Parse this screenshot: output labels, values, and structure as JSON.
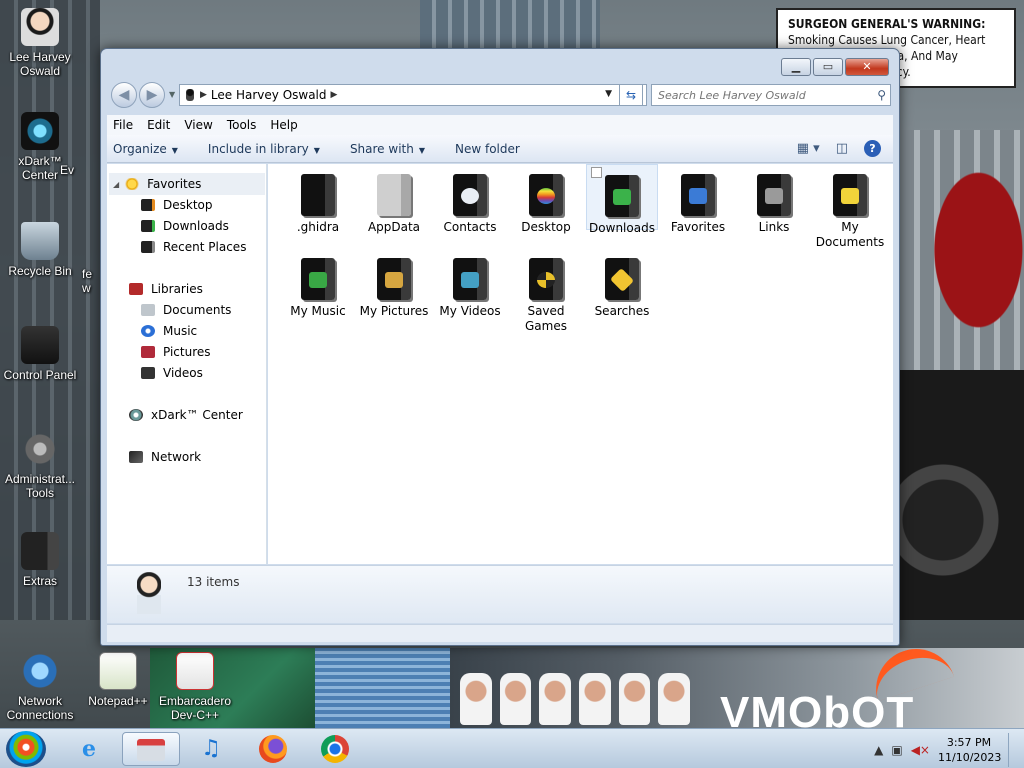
{
  "desktop": {
    "warning": {
      "title": "SURGEON GENERAL'S WARNING:",
      "body": "Smoking Causes Lung Cancer, Heart Disease, Emphysema, And May Complicate Pregnancy."
    },
    "icons": [
      {
        "label": "Lee Harvey Oswald"
      },
      {
        "label": "xDark™ Center"
      },
      {
        "label": "Recycle Bin"
      },
      {
        "label": "Control Panel"
      },
      {
        "label": "Administrat... Tools"
      },
      {
        "label": "Extras"
      },
      {
        "label": "Network Connections"
      },
      {
        "label": "Notepad++"
      },
      {
        "label": "Embarcadero Dev-C++"
      }
    ],
    "partial_labels": {
      "ev": "Ev",
      "fe": "fe",
      "w": "w"
    },
    "brand_text": "VMObOT"
  },
  "window": {
    "address": {
      "crumb": "Lee Harvey Oswald"
    },
    "search": {
      "placeholder": "Search Lee Harvey Oswald"
    },
    "menu": [
      "File",
      "Edit",
      "View",
      "Tools",
      "Help"
    ],
    "toolbar": {
      "organize": "Organize",
      "include": "Include in library",
      "share": "Share with",
      "new_folder": "New folder"
    },
    "nav": {
      "favorites": "Favorites",
      "fav_items": [
        "Desktop",
        "Downloads",
        "Recent Places"
      ],
      "libraries": "Libraries",
      "lib_items": [
        "Documents",
        "Music",
        "Pictures",
        "Videos"
      ],
      "xdark": "xDark™ Center",
      "network": "Network"
    },
    "items": [
      {
        "name": ".ghidra",
        "badge": "none"
      },
      {
        "name": "AppData",
        "badge": "gray"
      },
      {
        "name": "Contacts",
        "badge": "#e9eef5"
      },
      {
        "name": "Desktop",
        "badge": "#f29a1f"
      },
      {
        "name": "Downloads",
        "badge": "#3bb24a"
      },
      {
        "name": "Favorites",
        "badge": "#3b7bd6"
      },
      {
        "name": "Links",
        "badge": "#9a9a9a"
      },
      {
        "name": "My Documents",
        "badge": "#f1d43a"
      },
      {
        "name": "My Music",
        "badge": "#39a845"
      },
      {
        "name": "My Pictures",
        "badge": "#d6a640"
      },
      {
        "name": "My Videos",
        "badge": "#44a0c4"
      },
      {
        "name": "Saved Games",
        "badge": "#e8c02a"
      },
      {
        "name": "Searches",
        "badge": "#f2c531"
      }
    ],
    "selected_item": "Downloads",
    "status": {
      "count": "13 items"
    }
  },
  "taskbar": {
    "clock_time": "3:57 PM",
    "clock_date": "11/10/2023"
  }
}
